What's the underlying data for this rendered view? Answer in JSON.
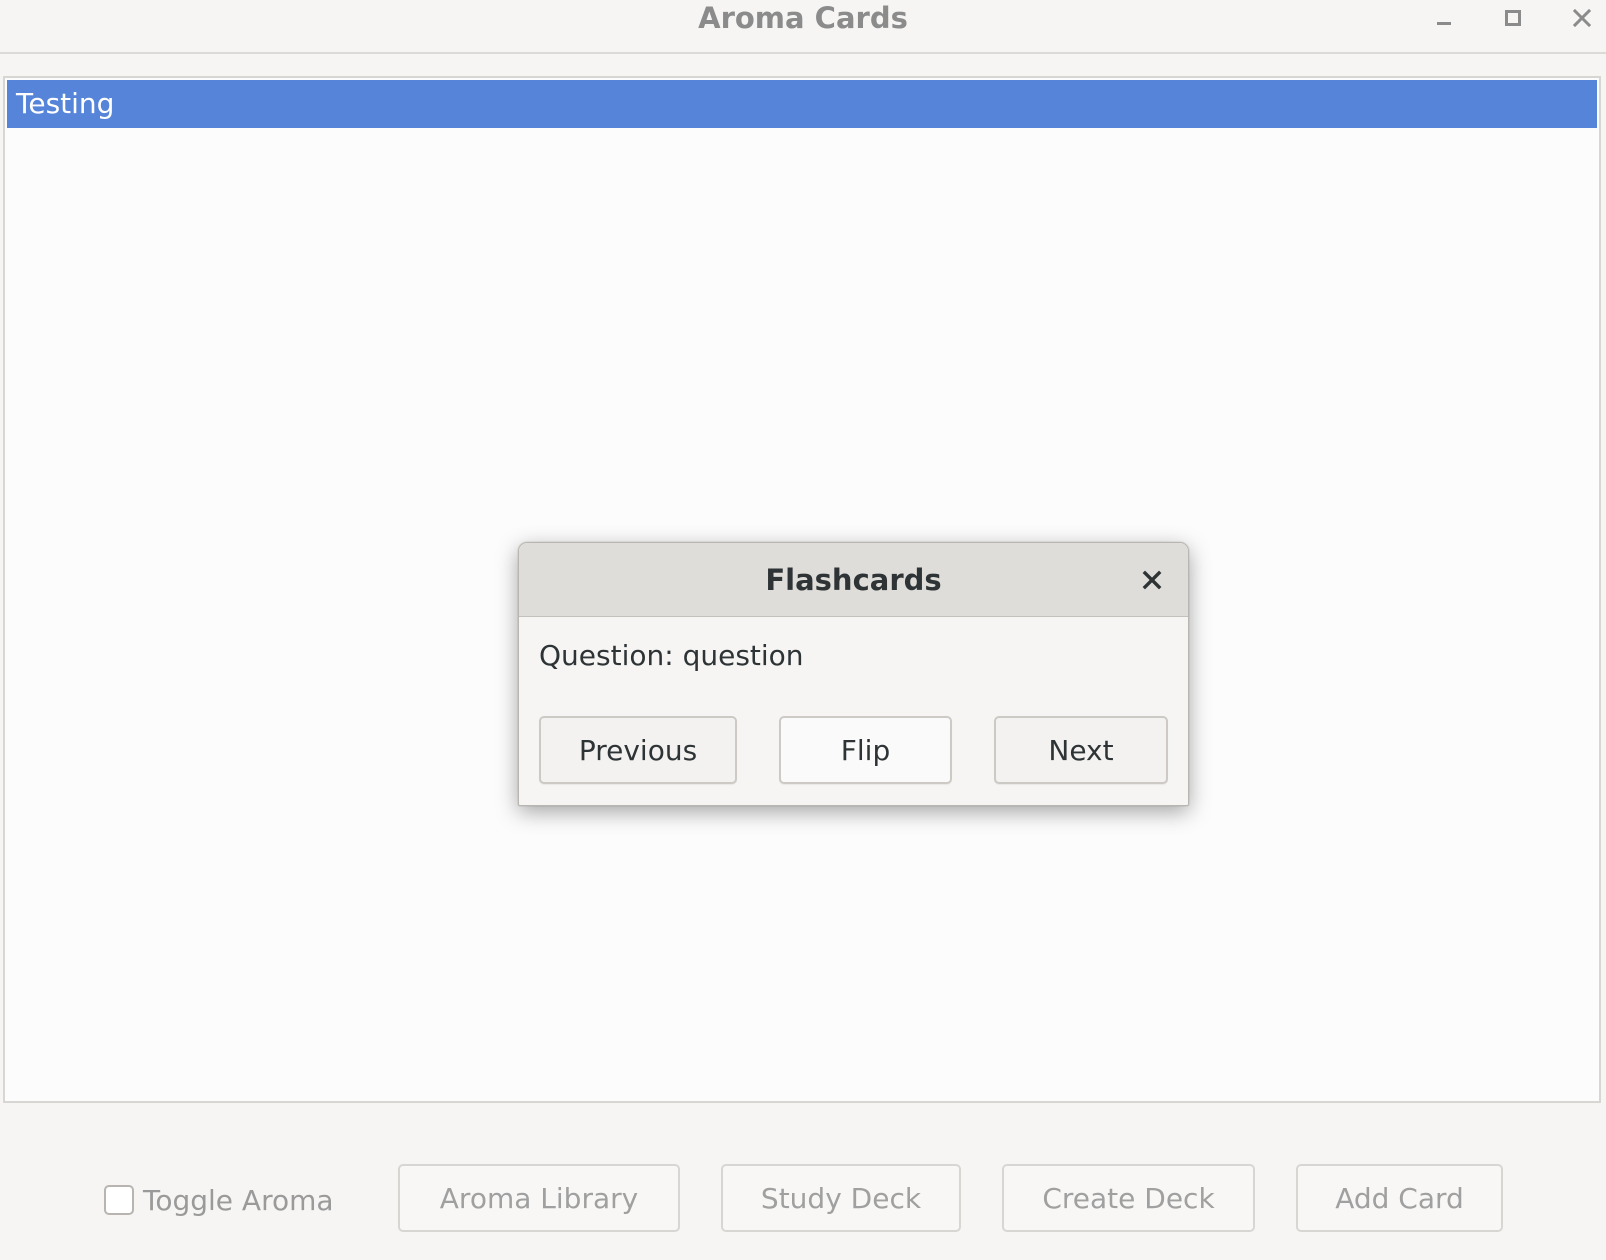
{
  "window": {
    "title": "Aroma Cards"
  },
  "deck_list": {
    "items": [
      {
        "label": "Testing",
        "selected": true
      }
    ],
    "selection_color": "#5584d8"
  },
  "dialog": {
    "title": "Flashcards",
    "question_text": "Question: question",
    "buttons": {
      "previous": "Previous",
      "flip": "Flip",
      "next": "Next"
    }
  },
  "toolbar": {
    "toggle_aroma_label": "Toggle Aroma",
    "toggle_aroma_checked": false,
    "aroma_library": "Aroma Library",
    "study_deck": "Study Deck",
    "create_deck": "Create Deck",
    "add_card": "Add Card"
  }
}
